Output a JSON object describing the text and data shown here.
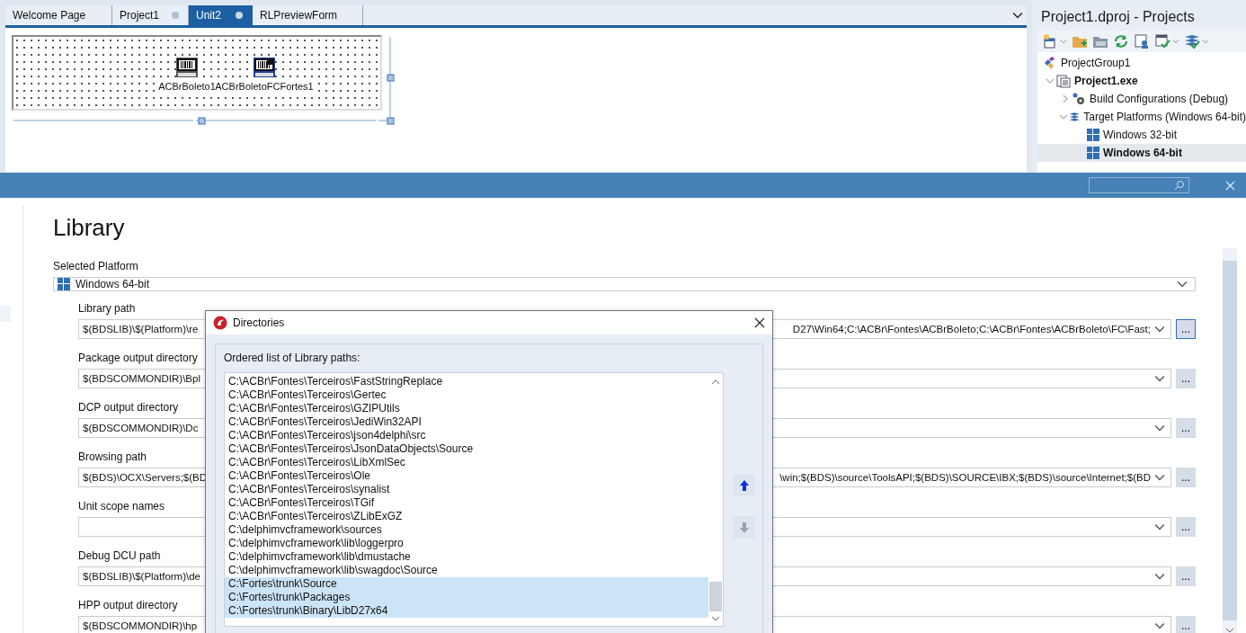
{
  "editor": {
    "tabs": [
      {
        "label": "Welcome Page",
        "selected": false,
        "modified": false
      },
      {
        "label": "Project1",
        "selected": false,
        "modified": true
      },
      {
        "label": "Unit2",
        "selected": true,
        "modified": true
      },
      {
        "label": "RLPreviewForm",
        "selected": false,
        "modified": false
      }
    ],
    "components": [
      {
        "label": "ACBrBoleto1",
        "kind": "boleto"
      },
      {
        "label": "ACBrBoletoFCFortes1",
        "kind": "report"
      }
    ]
  },
  "projects": {
    "title": "Project1.dproj - Projects",
    "toolbar": [
      {
        "kind": "new",
        "menu": true
      },
      {
        "kind": "add",
        "menu": false
      },
      {
        "kind": "folder",
        "menu": false
      },
      {
        "kind": "sync",
        "menu": false
      },
      {
        "kind": "options",
        "menu": false
      },
      {
        "kind": "build",
        "menu": true
      },
      {
        "kind": "stack",
        "menu": true
      }
    ],
    "tree": [
      {
        "label": "ProjectGroup1",
        "kind": "group",
        "bold": false,
        "selected": false
      },
      {
        "label": "Project1.exe",
        "kind": "project",
        "bold": true,
        "selected": false,
        "expanded": true,
        "children": [
          {
            "label": "Build Configurations (Debug)",
            "kind": "configs",
            "bold": false,
            "selected": false,
            "expanded": false
          },
          {
            "label": "Target Platforms (Windows 64-bit)",
            "kind": "platforms",
            "bold": false,
            "selected": false,
            "expanded": true,
            "children": [
              {
                "label": "Windows 32-bit",
                "kind": "platform",
                "bold": false,
                "selected": false
              },
              {
                "label": "Windows 64-bit",
                "kind": "platform",
                "bold": true,
                "selected": true
              }
            ]
          }
        ]
      }
    ]
  },
  "options": {
    "heading": "Library",
    "platform_label": "Selected Platform",
    "platform": "Windows 64-bit",
    "fields": [
      {
        "label": "Library path",
        "text_start": "$(BDSLIB)\\$(Platform)\\re",
        "text_end": "D27\\Win64;C:\\ACBr\\Fontes\\ACBrBoleto;C:\\ACBr\\Fontes\\ACBrBoleto\\FC\\Fast;",
        "button": "...",
        "focused": true
      },
      {
        "label": "Package output directory",
        "text_start": "$(BDSCOMMONDIR)\\Bpl",
        "button": "...",
        "focused": false
      },
      {
        "label": "DCP output directory",
        "text_start": "$(BDSCOMMONDIR)\\Dc",
        "button": "...",
        "focused": false
      },
      {
        "label": "Browsing path",
        "text_start": "$(BDS)\\OCX\\Servers;$(BD",
        "text_end": "\\win;$(BDS)\\source\\ToolsAPI;$(BDS)\\SOURCE\\IBX;$(BDS)\\source\\Internet;$(BD",
        "button": "...",
        "focused": false
      },
      {
        "label": "Unit scope names",
        "button": "...",
        "focused": false
      },
      {
        "label": "Debug DCU path",
        "text_start": "$(BDSLIB)\\$(Platform)\\de",
        "button": "...",
        "focused": false
      },
      {
        "label": "HPP output directory",
        "text_start": "$(BDSCOMMONDIR)\\hp",
        "button": "...",
        "focused": false
      }
    ]
  },
  "dialog": {
    "title": "Directories",
    "list_label": "Ordered list of Library paths:",
    "items": [
      {
        "text": "C:\\ACBr\\Fontes\\Terceiros\\FastStringReplace",
        "selected": false
      },
      {
        "text": "C:\\ACBr\\Fontes\\Terceiros\\Gertec",
        "selected": false
      },
      {
        "text": "C:\\ACBr\\Fontes\\Terceiros\\GZIPUtils",
        "selected": false
      },
      {
        "text": "C:\\ACBr\\Fontes\\Terceiros\\JediWin32API",
        "selected": false
      },
      {
        "text": "C:\\ACBr\\Fontes\\Terceiros\\json4delphi\\src",
        "selected": false
      },
      {
        "text": "C:\\ACBr\\Fontes\\Terceiros\\JsonDataObjects\\Source",
        "selected": false
      },
      {
        "text": "C:\\ACBr\\Fontes\\Terceiros\\LibXmlSec",
        "selected": false
      },
      {
        "text": "C:\\ACBr\\Fontes\\Terceiros\\Ole",
        "selected": false
      },
      {
        "text": "C:\\ACBr\\Fontes\\Terceiros\\synalist",
        "selected": false
      },
      {
        "text": "C:\\ACBr\\Fontes\\Terceiros\\TGif",
        "selected": false
      },
      {
        "text": "C:\\ACBr\\Fontes\\Terceiros\\ZLibExGZ",
        "selected": false
      },
      {
        "text": "C:\\delphimvcframework\\sources",
        "selected": false
      },
      {
        "text": "C:\\delphimvcframework\\lib\\loggerpro",
        "selected": false
      },
      {
        "text": "C:\\delphimvcframework\\lib\\dmustache",
        "selected": false
      },
      {
        "text": "C:\\delphimvcframework\\lib\\swagdoc\\Source",
        "selected": false
      },
      {
        "text": "C:\\Fortes\\trunk\\Source",
        "selected": true
      },
      {
        "text": "C:\\Fortes\\trunk\\Packages",
        "selected": true
      },
      {
        "text": "C:\\Fortes\\trunk\\Binary\\LibD27x64",
        "selected": true
      }
    ],
    "move_up": {
      "disabled": false
    },
    "move_down": {
      "disabled": true
    }
  }
}
